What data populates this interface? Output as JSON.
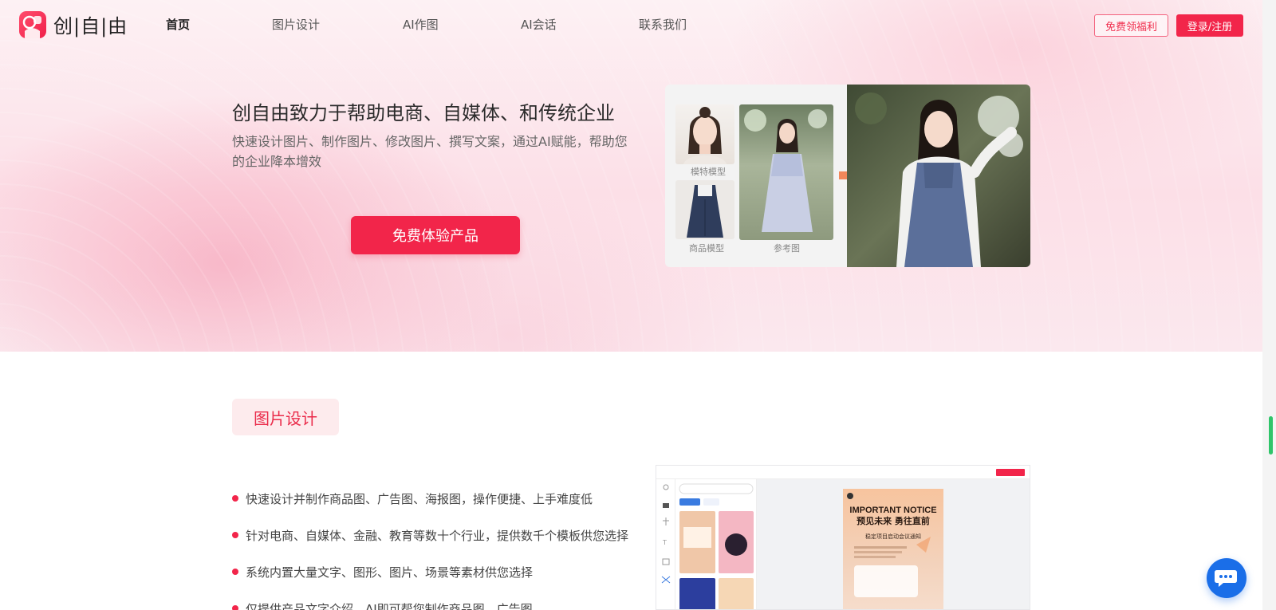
{
  "header": {
    "logo_text": "创|自|由",
    "nav": [
      {
        "label": "首页",
        "active": true
      },
      {
        "label": "图片设计",
        "active": false
      },
      {
        "label": "AI作图",
        "active": false
      },
      {
        "label": "AI会话",
        "active": false
      },
      {
        "label": "联系我们",
        "active": false
      }
    ],
    "welfare_label": "免费领福利",
    "login_label": "登录/注册"
  },
  "hero": {
    "title": "创自由致力于帮助电商、自媒体、和传统企业",
    "subtitle": "快速设计图片、制作图片、修改图片、撰写文案，通过AI赋能，帮助您的企业降本增效",
    "cta_label": "免费体验产品",
    "showcase": {
      "model_label": "模特模型",
      "product_label": "商品模型",
      "reference_label": "参考图"
    }
  },
  "design_section": {
    "tag": "图片设计",
    "features": [
      "快速设计并制作商品图、广告图、海报图，操作便捷、上手难度低",
      "针对电商、自媒体、金融、教育等数十个行业，提供数千个模板供您选择",
      "系统内置大量文字、图形、图片、场景等素材供您选择",
      "仅提供产品文字介绍，AI即可帮您制作商品图、广告图"
    ],
    "editor_preview": {
      "poster_heading": "IMPORTANT NOTICE",
      "poster_title": "预见未来 勇往直前",
      "poster_sub": "稳定项目启动会议通知"
    }
  },
  "theme": {
    "accent": "#f2254a",
    "chat_button": "#1a6ee8",
    "scroll_thumb": "#2fc56a"
  },
  "icons": {
    "logo": "logo-mark-icon",
    "arrow": "arrow-right-icon",
    "chat": "chat-bubble-icon"
  }
}
